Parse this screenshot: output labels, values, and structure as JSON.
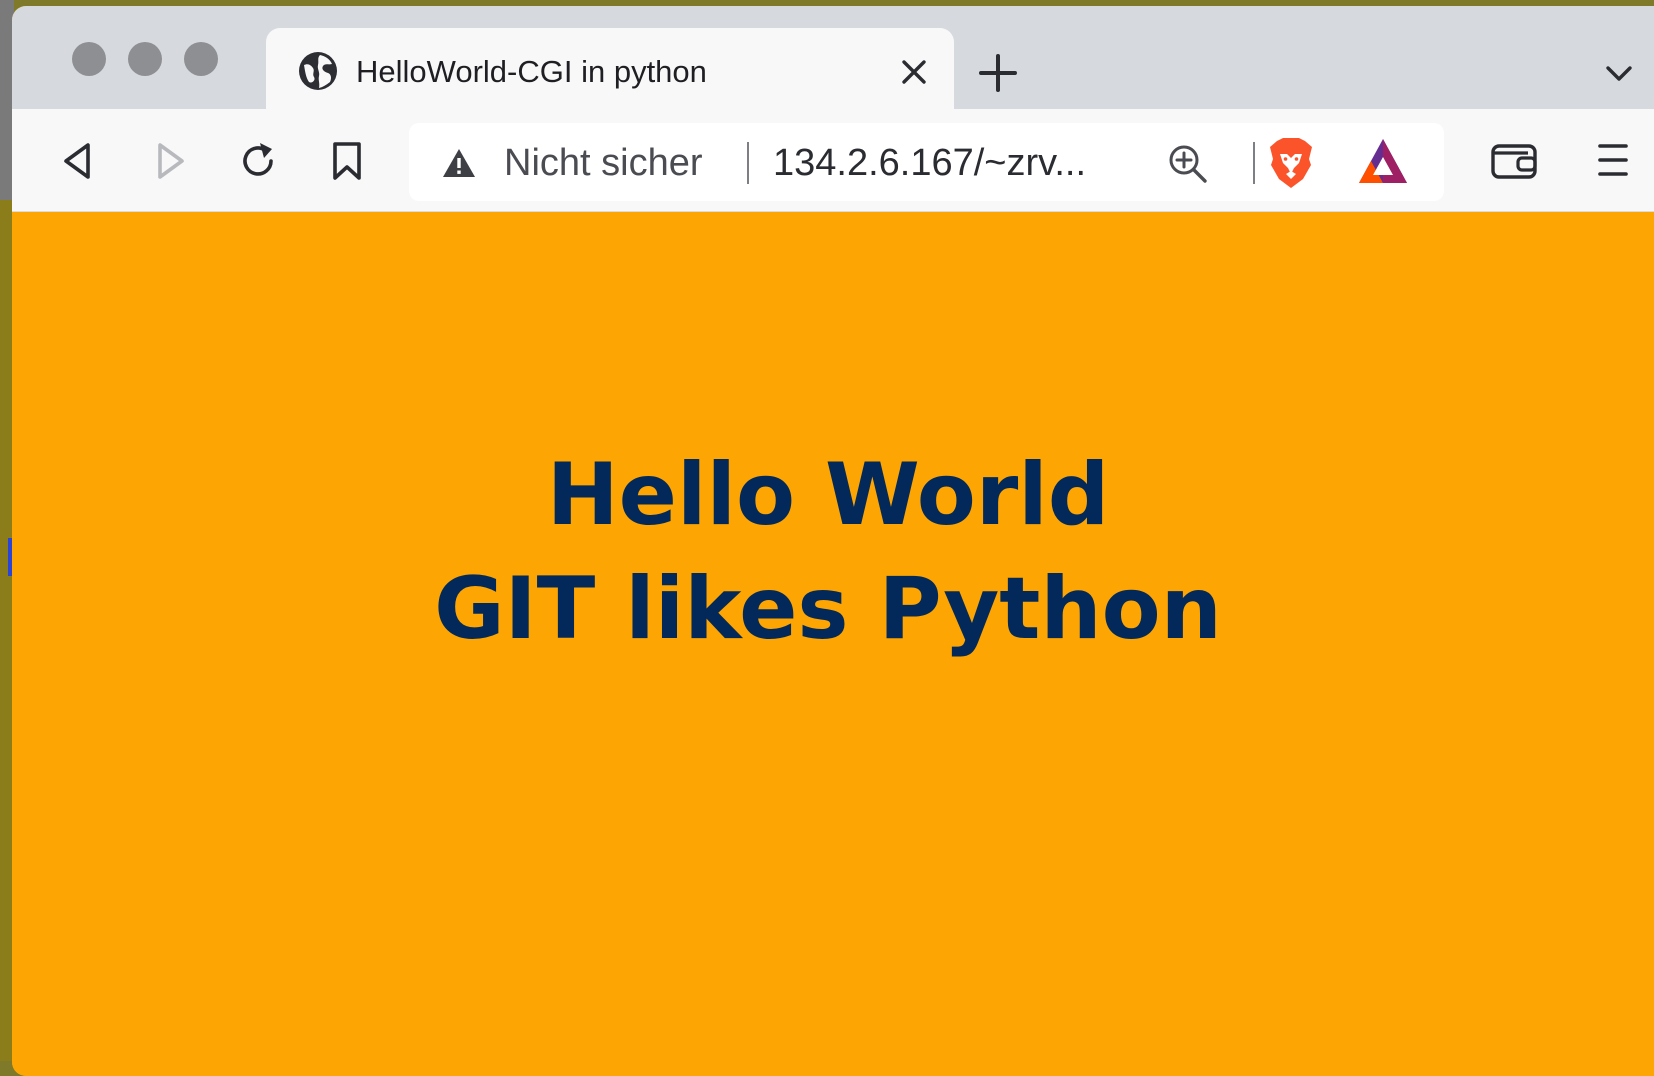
{
  "browser": {
    "tab": {
      "title": "HelloWorld-CGI in python",
      "favicon": "globe-icon"
    },
    "toolbar": {
      "back": "back-icon",
      "forward": "forward-icon",
      "reload": "reload-icon",
      "bookmark": "bookmark-icon",
      "wallet": "wallet-icon",
      "menu": "hamburger-menu-icon"
    },
    "address_bar": {
      "security_icon": "warning-triangle-icon",
      "security_label": "Nicht sicher",
      "url": "134.2.6.167/~zrv..."
    },
    "extensions": [
      "brave-shields-icon",
      "brave-rewards-icon"
    ]
  },
  "page": {
    "background_color": "#fda502",
    "text_color": "#03295a",
    "heading_lines": [
      "Hello World",
      "GIT likes Python"
    ]
  }
}
